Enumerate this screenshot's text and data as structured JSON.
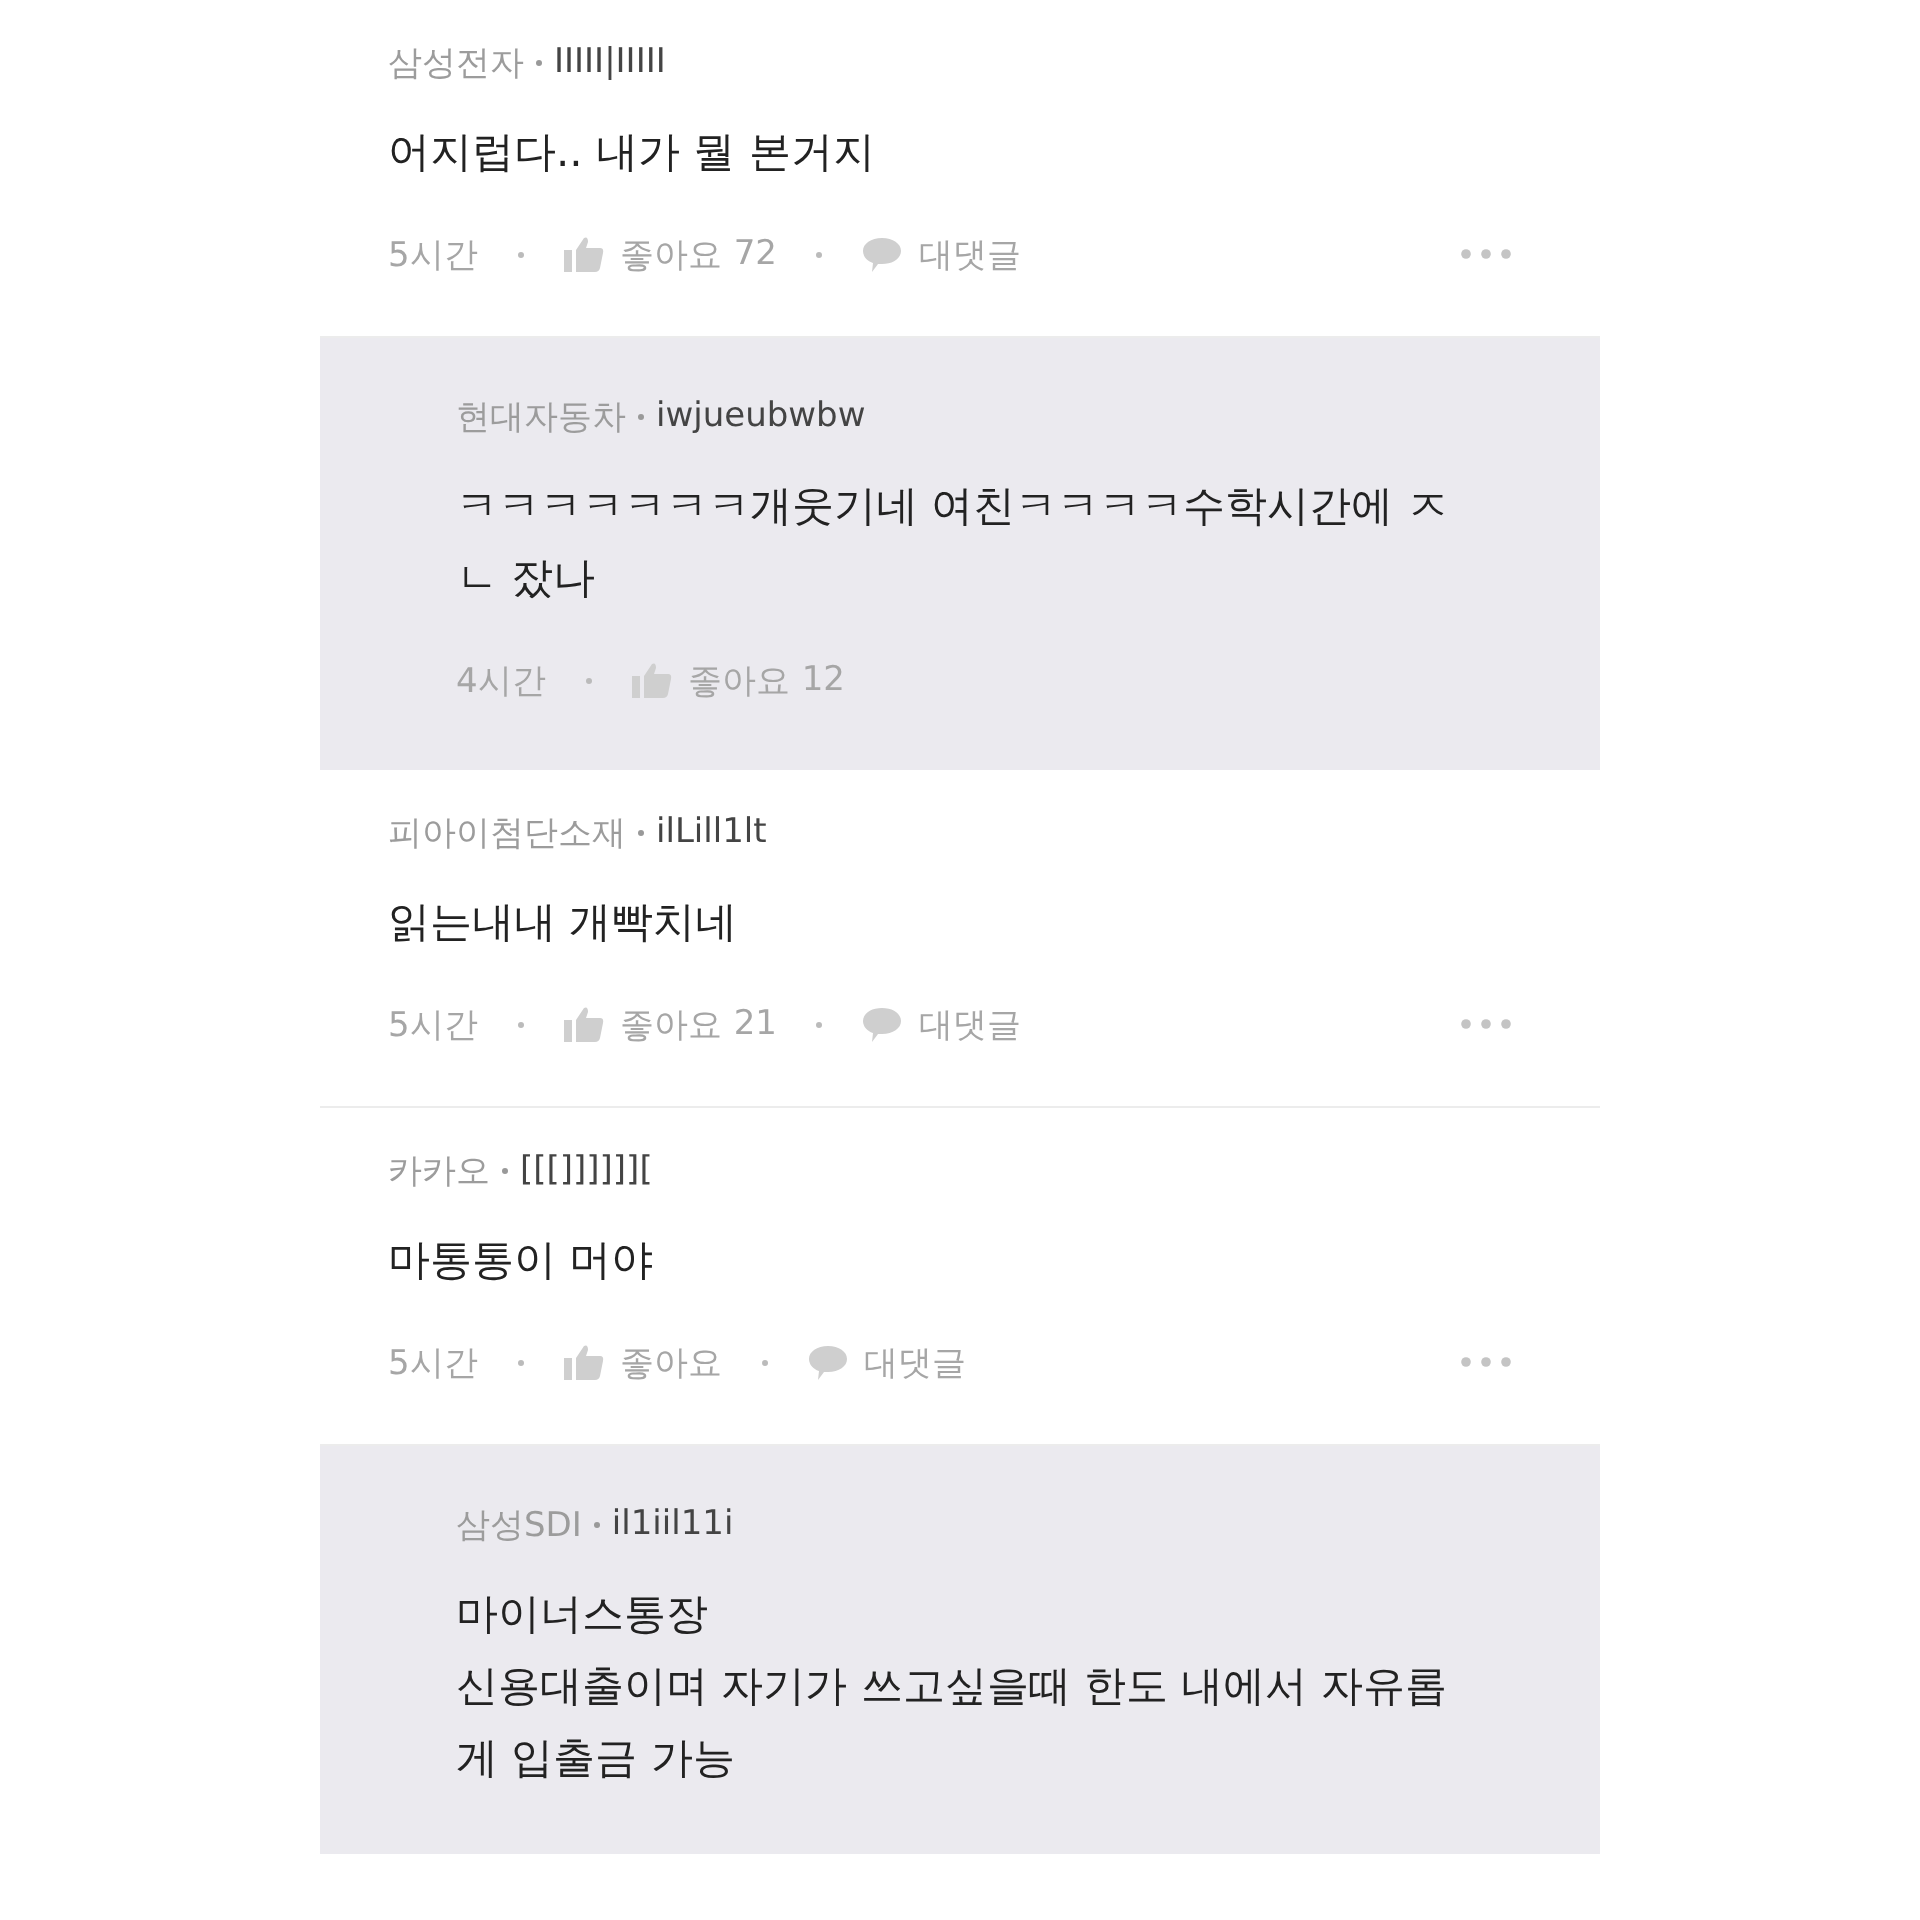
{
  "comments": [
    {
      "kind": "comment",
      "company": "삼성전자",
      "user": "IIIII|IIIII",
      "body": [
        "어지럽다.. 내가 뭘 본거지"
      ],
      "time": "5시간",
      "like_label": "좋아요",
      "likes": "72",
      "reply_label": "대댓글",
      "more": true
    },
    {
      "kind": "reply",
      "company": "현대자동차",
      "user": "iwjueubwbw",
      "body": [
        "ㅋㅋㅋㅋㅋㅋㅋ개웃기네 여친ㅋㅋㅋㅋ수학시간에 ㅈ",
        "ㄴ 잤나"
      ],
      "time": "4시간",
      "like_label": "좋아요",
      "likes": "12",
      "more": false
    },
    {
      "kind": "comment",
      "company": "피아이첨단소재",
      "user": "ilLill1lt",
      "body": [
        "읽는내내 개빡치네"
      ],
      "time": "5시간",
      "like_label": "좋아요",
      "likes": "21",
      "reply_label": "대댓글",
      "more": true
    },
    {
      "kind": "comment",
      "company": "카카오",
      "user": "[[[]]]]]][",
      "body": [
        "마통통이 머야"
      ],
      "time": "5시간",
      "like_label": "좋아요",
      "reply_label": "대댓글",
      "more": true
    },
    {
      "kind": "reply",
      "company": "삼성SDI",
      "user": "il1iil11i",
      "body": [
        "마이너스통장",
        "신용대출이며 자기가 쓰고싶을때 한도 내에서 자유롭",
        "게 입출금 가능"
      ],
      "more": false
    }
  ]
}
